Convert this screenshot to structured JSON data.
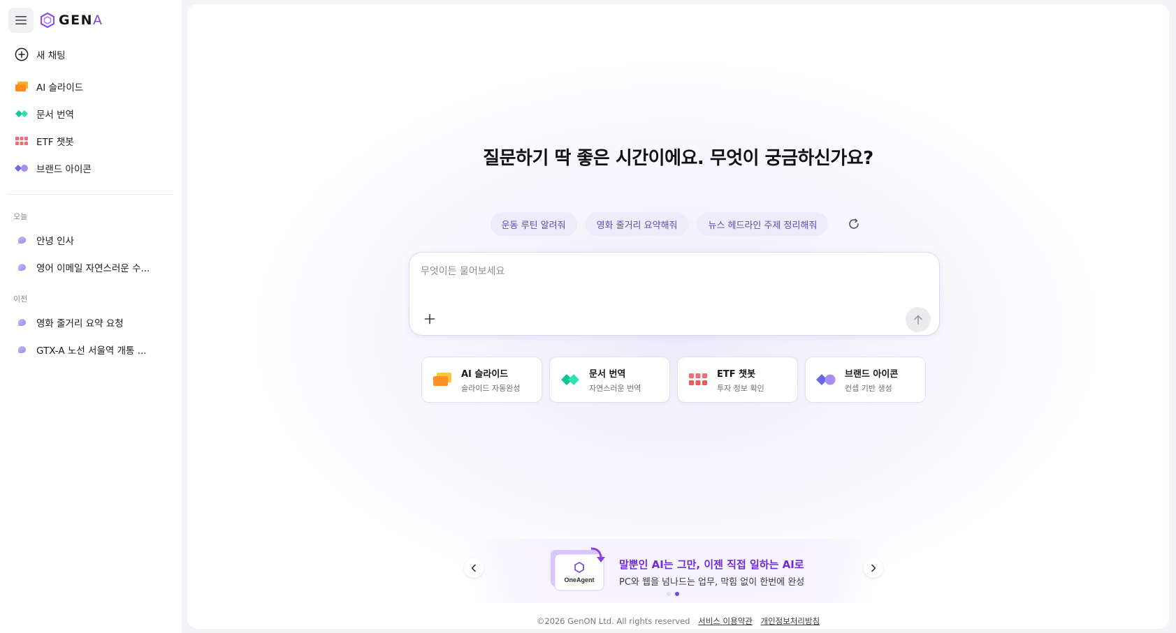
{
  "sidebar": {
    "logo_text": "GEN",
    "logo_accent": "A",
    "new_chat": "새 채팅",
    "tools": [
      {
        "label": "AI 슬라이드",
        "icon": "slides-icon"
      },
      {
        "label": "문서 번역",
        "icon": "translate-icon"
      },
      {
        "label": "ETF 챗봇",
        "icon": "etf-grid-icon"
      },
      {
        "label": "브랜드 아이콘",
        "icon": "brand-icon"
      }
    ],
    "sections": [
      {
        "title": "오늘",
        "chats": [
          "안녕 인사",
          "영어 이메일 자연스러운 수..."
        ]
      },
      {
        "title": "이전",
        "chats": [
          "영화 줄거리 요약 요청",
          "GTX-A 노선 서울역 개통 ..."
        ]
      }
    ]
  },
  "main": {
    "headline": "질문하기 딱 좋은 시간이에요. 무엇이 궁금하신가요?",
    "suggestions": [
      "운동 루틴 알려줘",
      "영화 줄거리 요약해줘",
      "뉴스 헤드라인 주제 정리해줘"
    ],
    "input_placeholder": "무엇이든 물어보세요",
    "cards": [
      {
        "title": "AI 슬라이드",
        "subtitle": "슬라이드 자동완성",
        "icon": "slides-icon"
      },
      {
        "title": "문서 번역",
        "subtitle": "자연스러운 번역",
        "icon": "translate-icon"
      },
      {
        "title": "ETF 챗봇",
        "subtitle": "투자 정보 확인",
        "icon": "etf-grid-icon"
      },
      {
        "title": "브랜드 아이콘",
        "subtitle": "컨셉 기반 생성",
        "icon": "brand-icon"
      }
    ],
    "promo": {
      "art_label": "OneAgent",
      "title": "말뿐인 AI는 그만, 이젠 직접 일하는 AI로",
      "subtitle": "PC와 웹을 넘나드는 업무, 막힘 없이 한번에 완성",
      "current_slide": 2,
      "total_slides": 2
    },
    "footer": {
      "copyright": "©2026 GenON Ltd. All rights reserved",
      "terms": "서비스 이용약관",
      "privacy": "개인정보처리방침"
    }
  },
  "colors": {
    "accent": "#7b45e0",
    "chip_bg": "#eeebfa",
    "chip_text": "#5a4fb0",
    "promo_title": "#6e2bd8"
  }
}
